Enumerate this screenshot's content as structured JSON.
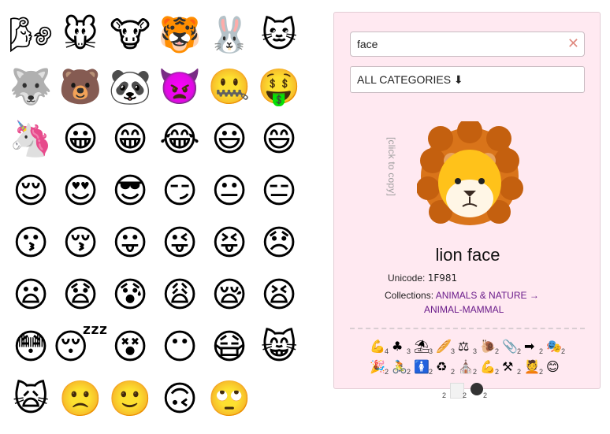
{
  "grid": [
    {
      "emoji": "🌬",
      "name": "wind blowing face"
    },
    {
      "emoji": "🐭",
      "name": "mouse face"
    },
    {
      "emoji": "🐮",
      "name": "cow face"
    },
    {
      "emoji": "🐯",
      "name": "tiger face"
    },
    {
      "emoji": "🐰",
      "name": "rabbit face"
    },
    {
      "emoji": "🐱",
      "name": "cat face"
    },
    {
      "emoji": "🐺",
      "name": "wolf face"
    },
    {
      "emoji": "🐻",
      "name": "bear face"
    },
    {
      "emoji": "🐼",
      "name": "panda face"
    },
    {
      "emoji": "👿",
      "name": "imp"
    },
    {
      "emoji": "🤐",
      "name": "zipper-mouth face"
    },
    {
      "emoji": "🤑",
      "name": "money-mouth face"
    },
    {
      "emoji": "🦄",
      "name": "unicorn face"
    },
    {
      "emoji": "😀",
      "name": "grinning face"
    },
    {
      "emoji": "😁",
      "name": "grinning face with smiling eyes"
    },
    {
      "emoji": "😂",
      "name": "face with tears of joy"
    },
    {
      "emoji": "😃",
      "name": "smiling face with open mouth"
    },
    {
      "emoji": "😄",
      "name": "smiling face with open mouth and smiling eyes"
    },
    {
      "emoji": "😌",
      "name": "relieved face"
    },
    {
      "emoji": "😍",
      "name": "smiling face with heart-eyes"
    },
    {
      "emoji": "😎",
      "name": "smiling face with sunglasses"
    },
    {
      "emoji": "😏",
      "name": "smirking face"
    },
    {
      "emoji": "😐",
      "name": "neutral face"
    },
    {
      "emoji": "😑",
      "name": "expressionless face"
    },
    {
      "emoji": "😗",
      "name": "kissing face"
    },
    {
      "emoji": "😚",
      "name": "kissing face with closed eyes"
    },
    {
      "emoji": "😛",
      "name": "face with stuck-out tongue"
    },
    {
      "emoji": "😜",
      "name": "winking face with stuck-out tongue"
    },
    {
      "emoji": "😝",
      "name": "squinting face with tongue"
    },
    {
      "emoji": "😞",
      "name": "disappointed face"
    },
    {
      "emoji": "😦",
      "name": "frowning face with open mouth"
    },
    {
      "emoji": "😧",
      "name": "anguished face"
    },
    {
      "emoji": "😰",
      "name": "anxious face with sweat"
    },
    {
      "emoji": "😩",
      "name": "weary face"
    },
    {
      "emoji": "😪",
      "name": "sleepy face"
    },
    {
      "emoji": "😫",
      "name": "tired face"
    },
    {
      "emoji": "😳",
      "name": "flushed face"
    },
    {
      "emoji": "😴",
      "name": "sleeping face"
    },
    {
      "emoji": "😵",
      "name": "dizzy face"
    },
    {
      "emoji": "😶",
      "name": "face without mouth"
    },
    {
      "emoji": "😷",
      "name": "face with medical mask"
    },
    {
      "emoji": "😸",
      "name": "grinning cat face"
    },
    {
      "emoji": "🙀",
      "name": "weary cat face"
    },
    {
      "emoji": "🙁",
      "name": "slightly frowning face"
    },
    {
      "emoji": "🙂",
      "name": "slightly smiling face"
    },
    {
      "emoji": "🙃",
      "name": "upside-down face"
    },
    {
      "emoji": "🙄",
      "name": "face with rolling eyes"
    }
  ],
  "search": {
    "value": "face",
    "clear_symbol": "✕"
  },
  "category_select": {
    "label": "ALL CATEGORIES ⬇"
  },
  "detail": {
    "click_hint": "[click to copy]",
    "emoji": "🦁",
    "name": "lion face",
    "unicode_label": "Unicode:",
    "unicode_value": "1F981",
    "collections_label": "Collections:",
    "collection_1": "ANIMALS & NATURE →",
    "collection_2": "ANIMAL-MAMMAL"
  },
  "related": [
    {
      "emoji": "💪",
      "count": "4"
    },
    {
      "emoji": "♣",
      "count": "3"
    },
    {
      "emoji": "⛱",
      "count": "3"
    },
    {
      "emoji": "🥖",
      "count": "3"
    },
    {
      "emoji": "⚖",
      "count": "3"
    },
    {
      "emoji": "🐌",
      "count": "2"
    },
    {
      "emoji": "📎",
      "count": "2"
    },
    {
      "emoji": "➡",
      "count": "2"
    },
    {
      "emoji": "🎭",
      "count": "2"
    },
    {
      "emoji": "🎉",
      "count": "2"
    },
    {
      "emoji": "🚴",
      "count": "2"
    },
    {
      "emoji": "🚺",
      "count": "2"
    },
    {
      "emoji": "♻",
      "count": "2"
    },
    {
      "emoji": "⛪",
      "count": "2"
    },
    {
      "emoji": "💪",
      "count": "2"
    },
    {
      "emoji": "⚒",
      "count": "2"
    },
    {
      "emoji": "💆",
      "count": "2"
    },
    {
      "emoji": "😊",
      "count": ""
    }
  ],
  "related_overflow": [
    {
      "count": "2"
    },
    {
      "count": "2"
    },
    {
      "count": "2"
    }
  ]
}
